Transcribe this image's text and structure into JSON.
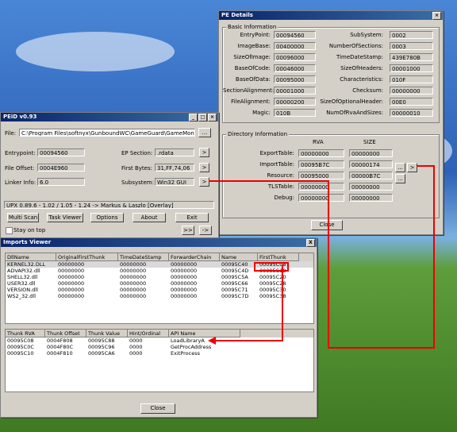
{
  "peid": {
    "title": "PEiD v0.93",
    "file_label": "File:",
    "file_value": "C:\\Program Files\\softnyx\\GunboundWC\\GameGuard\\GameMon.des",
    "file_btn": "...",
    "entrypoint_label": "Entrypoint:",
    "entrypoint_value": "00094560",
    "ep_section_label": "EP Section:",
    "ep_section_value": ".rdata",
    "file_offset_label": "File Offset:",
    "file_offset_value": "0004E960",
    "first_bytes_label": "First Bytes:",
    "first_bytes_value": "31,FF,74,06",
    "linker_label": "Linker Info:",
    "linker_value": "6.0",
    "subsystem_label": "Subsystem:",
    "subsystem_value": "Win32 GUI",
    "arrow_btn": ">",
    "detection": "UPX 0.89.6 - 1.02 / 1.05 - 1.24 -> Markus & Laszlo [Overlay]",
    "buttons": [
      "Multi Scan",
      "Task Viewer",
      "Options",
      "About",
      "Exit"
    ],
    "stay_on_top": "Stay on top",
    "nav_btn1": ">>",
    "nav_btn2": "->"
  },
  "pe": {
    "title": "PE Details",
    "basic_title": "Basic Information",
    "left_fields": [
      {
        "label": "EntryPoint:",
        "value": "00094560"
      },
      {
        "label": "ImageBase:",
        "value": "00400000"
      },
      {
        "label": "SizeOfImage:",
        "value": "00096000"
      },
      {
        "label": "BaseOfCode:",
        "value": "00046000"
      },
      {
        "label": "BaseOfData:",
        "value": "00095000"
      },
      {
        "label": "SectionAlignment:",
        "value": "00001000"
      },
      {
        "label": "FileAlignment:",
        "value": "00000200"
      },
      {
        "label": "Magic:",
        "value": "010B"
      }
    ],
    "right_fields": [
      {
        "label": "SubSystem:",
        "value": "0002"
      },
      {
        "label": "NumberOfSections:",
        "value": "0003"
      },
      {
        "label": "TimeDateStamp:",
        "value": "439E780B"
      },
      {
        "label": "SizeOfHeaders:",
        "value": "00001000"
      },
      {
        "label": "Characteristics:",
        "value": "010F"
      },
      {
        "label": "Checksum:",
        "value": "00000000"
      },
      {
        "label": "SizeOfOptionalHeader:",
        "value": "00E0"
      },
      {
        "label": "NumOfRvaAndSizes:",
        "value": "00000010"
      }
    ],
    "dir_title": "Directory Information",
    "rva_header": "RVA",
    "size_header": "SIZE",
    "dirs": [
      {
        "label": "ExportTable:",
        "rva": "00000000",
        "size": "00000000"
      },
      {
        "label": "ImportTable:",
        "rva": "00095B7C",
        "size": "00000174"
      },
      {
        "label": "Resource:",
        "rva": "00095000",
        "size": "00000B7C"
      },
      {
        "label": "TLSTable:",
        "rva": "00000000",
        "size": "00000000"
      },
      {
        "label": "Debug:",
        "rva": "00000000",
        "size": "00000000"
      }
    ],
    "dots_btn": "...",
    "gt_btn": ">",
    "close_btn": "Close"
  },
  "imports": {
    "title": "Imports Viewer",
    "close_x": "X",
    "dll_headers": [
      "DllName",
      "OriginalFirstThunk",
      "TimeDateStamp",
      "ForwarderChain",
      "Name",
      "FirstThunk"
    ],
    "dll_rows": [
      [
        "KERNEL32.DLL",
        "00000000",
        "00000000",
        "00000000",
        "00095C40",
        "00095C08"
      ],
      [
        "ADVAPI32.dll",
        "00000000",
        "00000000",
        "00000000",
        "00095C4D",
        "00095C18"
      ],
      [
        "SHELL32.dll",
        "00000000",
        "00000000",
        "00000000",
        "00095C5A",
        "00095C20"
      ],
      [
        "USER32.dll",
        "00000000",
        "00000000",
        "00000000",
        "00095C66",
        "00095C28"
      ],
      [
        "VERSION.dll",
        "00000000",
        "00000000",
        "00000000",
        "00095C71",
        "00095C30"
      ],
      [
        "WS2_32.dll",
        "00000000",
        "00000000",
        "00000000",
        "00095C7D",
        "00095C38"
      ]
    ],
    "thunk_headers": [
      "Thunk RVA",
      "Thunk Offset",
      "Thunk Value",
      "Hint/Ordinal",
      "API Name"
    ],
    "thunk_rows": [
      [
        "00095C08",
        "0004F808",
        "00095C88",
        "0000",
        "LoadLibraryA"
      ],
      [
        "00095C0C",
        "0004F80C",
        "00095C96",
        "0000",
        "GetProcAddress"
      ],
      [
        "00095C10",
        "0004F810",
        "00095CA6",
        "0000",
        "ExitProcess"
      ]
    ],
    "close_btn": "Close"
  },
  "colors": {
    "annotation_red": "#ee0000",
    "titlebar": "#0a246a"
  }
}
